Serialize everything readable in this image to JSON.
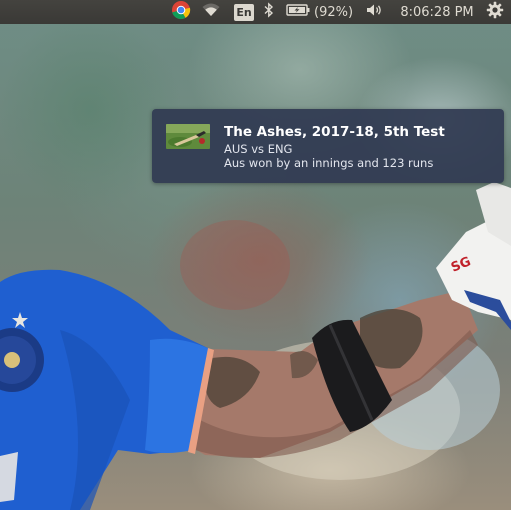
{
  "top_panel": {
    "keyboard_layout": "En",
    "battery_percent": "(92%)",
    "clock": "8:06:28 PM",
    "icons": {
      "chrome": "chrome-icon",
      "wifi": "wifi-icon",
      "bluetooth": "bluetooth-icon",
      "battery": "battery-charging-icon",
      "sound": "speaker-icon",
      "settings": "gear-icon"
    }
  },
  "notification": {
    "title": "The Ashes, 2017-18, 5th Test",
    "line1": "AUS vs ENG",
    "line2": "Aus won by an innings and 123 runs"
  },
  "colors": {
    "panel_bg": "#3c3b37",
    "notification_bg": "#303a52",
    "jersey_blue": "#1f5fd0"
  }
}
